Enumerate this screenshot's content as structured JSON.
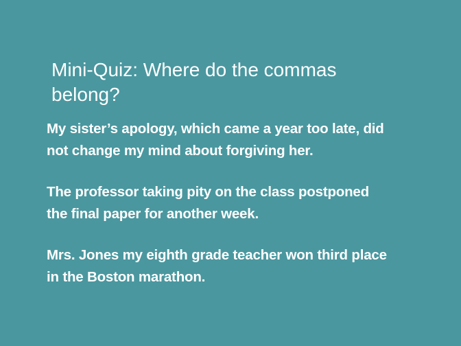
{
  "slide": {
    "title_lines": [
      "Mini-Quiz: Where do the commas",
      "belong?"
    ],
    "sentences": [
      {
        "lines": [
          "My sister’s apology, which came a year too late, did",
          "not change my mind about forgiving her."
        ]
      },
      {
        "lines": [
          "The professor taking pity on the class postponed",
          "the final paper for another week."
        ]
      },
      {
        "lines": [
          "Mrs. Jones my eighth grade teacher won third place",
          "in the Boston marathon."
        ]
      }
    ]
  },
  "colors": {
    "background": "#4a979f",
    "text": "#ffffff"
  }
}
